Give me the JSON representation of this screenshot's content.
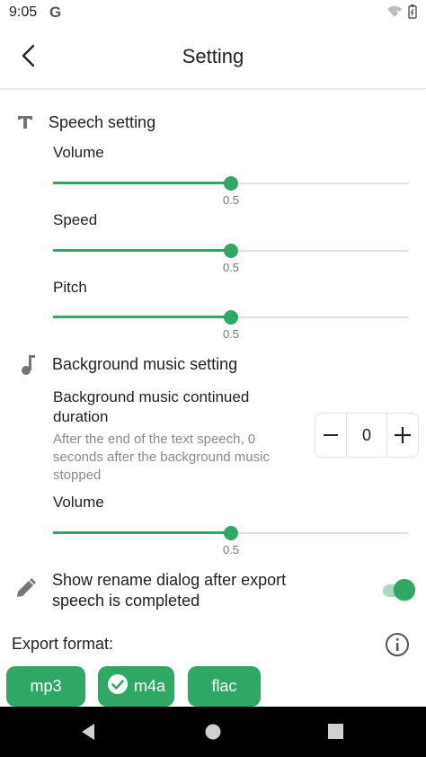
{
  "status_bar": {
    "time": "9:05",
    "g_letter": "G"
  },
  "app_bar": {
    "title": "Setting"
  },
  "speech": {
    "title": "Speech setting",
    "volume": {
      "label": "Volume",
      "value": "0.5",
      "fraction": 0.5
    },
    "speed": {
      "label": "Speed",
      "value": "0.5",
      "fraction": 0.5
    },
    "pitch": {
      "label": "Pitch",
      "value": "0.5",
      "fraction": 0.5
    }
  },
  "music": {
    "title": "Background music setting",
    "duration_label_1": "Background music continued",
    "duration_label_2": "duration",
    "desc_1": "After the end of the text speech, 0",
    "desc_2": "seconds after the background music",
    "desc_3": "stopped",
    "stepper_value": "0",
    "volume": {
      "label": "Volume",
      "value": "0.5",
      "fraction": 0.5
    }
  },
  "rename": {
    "label_1": "Show rename dialog after export",
    "label_2": "speech is completed",
    "enabled": true
  },
  "export": {
    "label": "Export format:",
    "formats": [
      {
        "label": "mp3",
        "selected": false
      },
      {
        "label": "m4a",
        "selected": true
      },
      {
        "label": "flac",
        "selected": false
      }
    ]
  },
  "colors": {
    "accent": "#2fa866",
    "accent_light": "#a8dcbf"
  },
  "icons": [
    "back-arrow-icon",
    "text-t-icon",
    "music-note-icon",
    "pencil-icon",
    "info-icon",
    "check-circle-icon",
    "wifi-icon",
    "battery-icon"
  ]
}
